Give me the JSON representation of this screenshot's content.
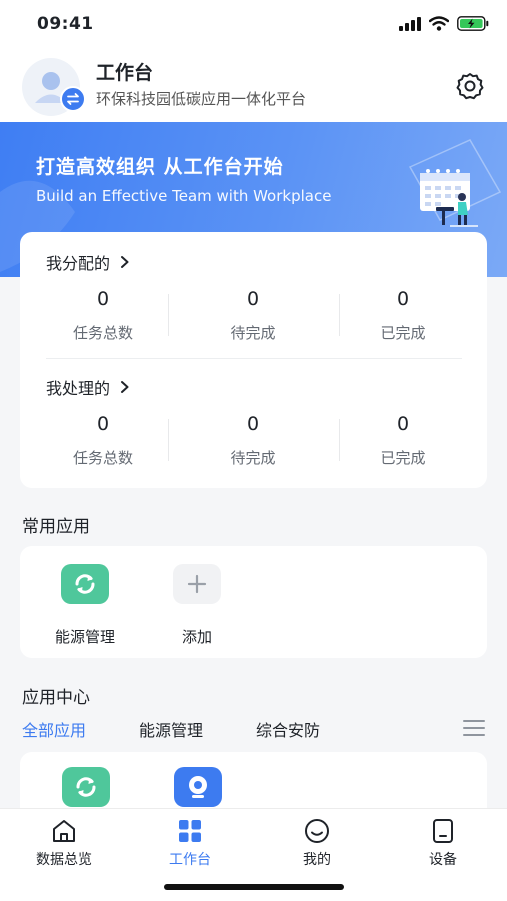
{
  "status_bar": {
    "time": "09:41"
  },
  "header": {
    "title": "工作台",
    "subtitle": "环保科技园低碳应用一体化平台"
  },
  "banner": {
    "title": "打造高效组织 从工作台开始",
    "subtitle": "Build an Effective Team with Workplace"
  },
  "assigned": {
    "title": "我分配的",
    "stats": [
      {
        "value": "0",
        "label": "任务总数"
      },
      {
        "value": "0",
        "label": "待完成"
      },
      {
        "value": "0",
        "label": "已完成"
      }
    ]
  },
  "handled": {
    "title": "我处理的",
    "stats": [
      {
        "value": "0",
        "label": "任务总数"
      },
      {
        "value": "0",
        "label": "待完成"
      },
      {
        "value": "0",
        "label": "已完成"
      }
    ]
  },
  "common_apps": {
    "title": "常用应用",
    "items": [
      {
        "label": "能源管理",
        "icon": "energy-icon"
      },
      {
        "label": "添加",
        "icon": "plus-icon"
      }
    ]
  },
  "app_center": {
    "title": "应用中心",
    "tabs": [
      {
        "label": "全部应用"
      },
      {
        "label": "能源管理"
      },
      {
        "label": "综合安防"
      }
    ]
  },
  "bottom_nav": [
    {
      "label": "数据总览",
      "icon": "home-icon"
    },
    {
      "label": "工作台",
      "icon": "grid-icon"
    },
    {
      "label": "我的",
      "icon": "smile-icon"
    },
    {
      "label": "设备",
      "icon": "device-icon"
    }
  ],
  "colors": {
    "accent": "#3d7bf0",
    "app_green": "#4fc79b",
    "background": "#f5f6f8"
  }
}
